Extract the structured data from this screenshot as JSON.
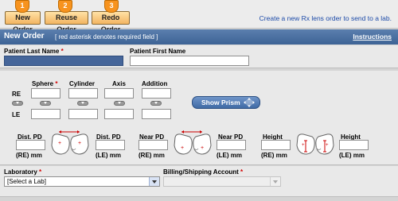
{
  "toolbar": {
    "buttons": [
      {
        "badge": "1",
        "label": "New Order"
      },
      {
        "badge": "2",
        "label": "Reuse Order"
      },
      {
        "badge": "3",
        "label": "Redo Order"
      }
    ],
    "create_link": "Create a new Rx lens order to send to a lab."
  },
  "header": {
    "title": "New Order",
    "subtitle": "[ red asterisk denotes required field ]",
    "instructions_link": "Instructions"
  },
  "patient": {
    "last_name_label": "Patient Last Name",
    "first_name_label": "Patient First Name",
    "required_mark": "*"
  },
  "rx": {
    "columns": {
      "sphere": "Sphere",
      "cylinder": "Cylinder",
      "axis": "Axis",
      "addition": "Addition"
    },
    "rows": {
      "re": "RE",
      "le": "LE"
    },
    "show_prism_label": "Show Prism"
  },
  "measurements": {
    "dist_pd_re": "Dist. PD",
    "dist_pd_le": "Dist. PD",
    "near_pd_re": "Near PD",
    "near_pd_le": "Near PD",
    "height_re": "Height",
    "height_le": "Height",
    "re_mm": "(RE) mm",
    "le_mm": "(LE) mm"
  },
  "lab": {
    "laboratory_label": "Laboratory",
    "laboratory_value": "[Select a Lab]",
    "billing_label": "Billing/Shipping Account",
    "billing_value": ""
  },
  "colors": {
    "header_blue": "#3d6395",
    "button_orange": "#f3b562",
    "badge_orange": "#f7931e",
    "link_blue": "#1c4aa8",
    "required_red": "#d40000"
  }
}
